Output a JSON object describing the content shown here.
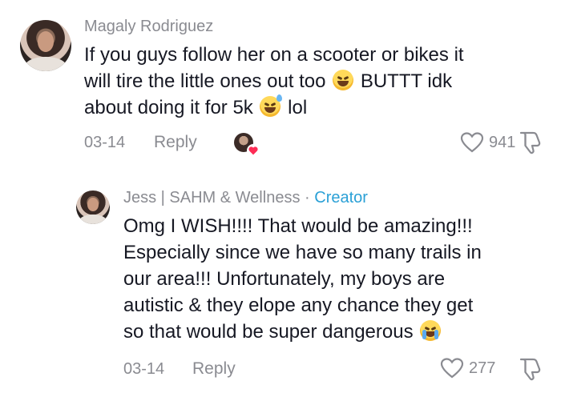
{
  "comments": [
    {
      "username": "Magaly Rodriguez",
      "text_parts": [
        "If you guys follow her on a scooter or bikes it",
        "will tire the little ones out too",
        "BUTTT idk",
        "about doing it for 5k",
        "lol"
      ],
      "date": "03-14",
      "reply_label": "Reply",
      "likes": "941",
      "liked_by_creator": true
    },
    {
      "username": "Jess | SAHM & Wellness",
      "separator": "·",
      "badge": "Creator",
      "text_lines": [
        "Omg I WISH!!!! That would be amazing!!!",
        "Especially since we have so many trails in",
        "our area!!! Unfortunately, my boys are",
        "autistic & they elope any chance they get",
        "so that would be super dangerous"
      ],
      "date": "03-14",
      "reply_label": "Reply",
      "likes": "277"
    }
  ],
  "icons": {
    "emoji_1": "grinning-squinting-face-emoji",
    "emoji_2": "grinning-sweat-face-emoji",
    "emoji_3": "loudly-crying-face-emoji",
    "like": "heart-outline-icon",
    "dislike": "thumbs-down-icon",
    "creator_like": "heart-badge-icon"
  },
  "colors": {
    "username": "#8a8b91",
    "text": "#161823",
    "creator_badge": "#2aa0d6",
    "heart_badge": "#fe2c55"
  }
}
